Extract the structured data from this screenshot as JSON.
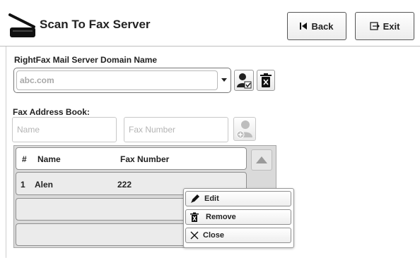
{
  "header": {
    "title": "Scan To Fax Server",
    "back_label": "Back",
    "exit_label": "Exit"
  },
  "domain": {
    "label": "RightFax Mail Server Domain Name",
    "value": "abc.com"
  },
  "address_book": {
    "label": "Fax Address Book:",
    "name_placeholder": "Name",
    "fax_placeholder": "Fax Number",
    "columns": {
      "num": "#",
      "name": "Name",
      "fax": "Fax Number"
    },
    "rows": [
      {
        "num": "1",
        "name": "Alen",
        "fax": "222"
      }
    ]
  },
  "context_menu": {
    "edit": "Edit",
    "remove": "Remove",
    "close": "Close"
  },
  "icons": {
    "scanner": "scanner-icon",
    "back": "back-arrow-icon",
    "exit": "exit-icon",
    "dropdown": "chevron-down-icon",
    "user_select": "user-select-icon",
    "delete": "trash-icon",
    "add_contact": "add-contact-icon",
    "scroll_up": "triangle-up-icon",
    "edit": "pencil-icon",
    "remove": "trash-icon",
    "close": "x-icon"
  }
}
